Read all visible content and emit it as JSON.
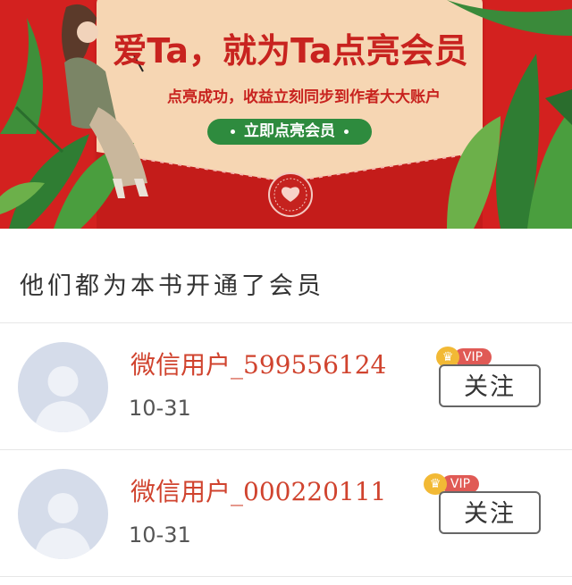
{
  "banner": {
    "title": "爱Ta，就为Ta点亮会员",
    "subtitle": "点亮成功，收益立刻同步到作者大大账户",
    "cta_label": "立即点亮会员"
  },
  "section": {
    "title": "他们都为本书开通了会员"
  },
  "members": [
    {
      "name": "微信用户_599556124",
      "date": "10-31",
      "vip": "VIP",
      "follow_label": "关注"
    },
    {
      "name": "微信用户_000220111",
      "date": "10-31",
      "vip": "VIP",
      "follow_label": "关注"
    }
  ],
  "colors": {
    "banner_red": "#d3211f",
    "name_red": "#d0432e",
    "button_green": "#2e8b3e",
    "vip_gold": "#f2b935"
  }
}
